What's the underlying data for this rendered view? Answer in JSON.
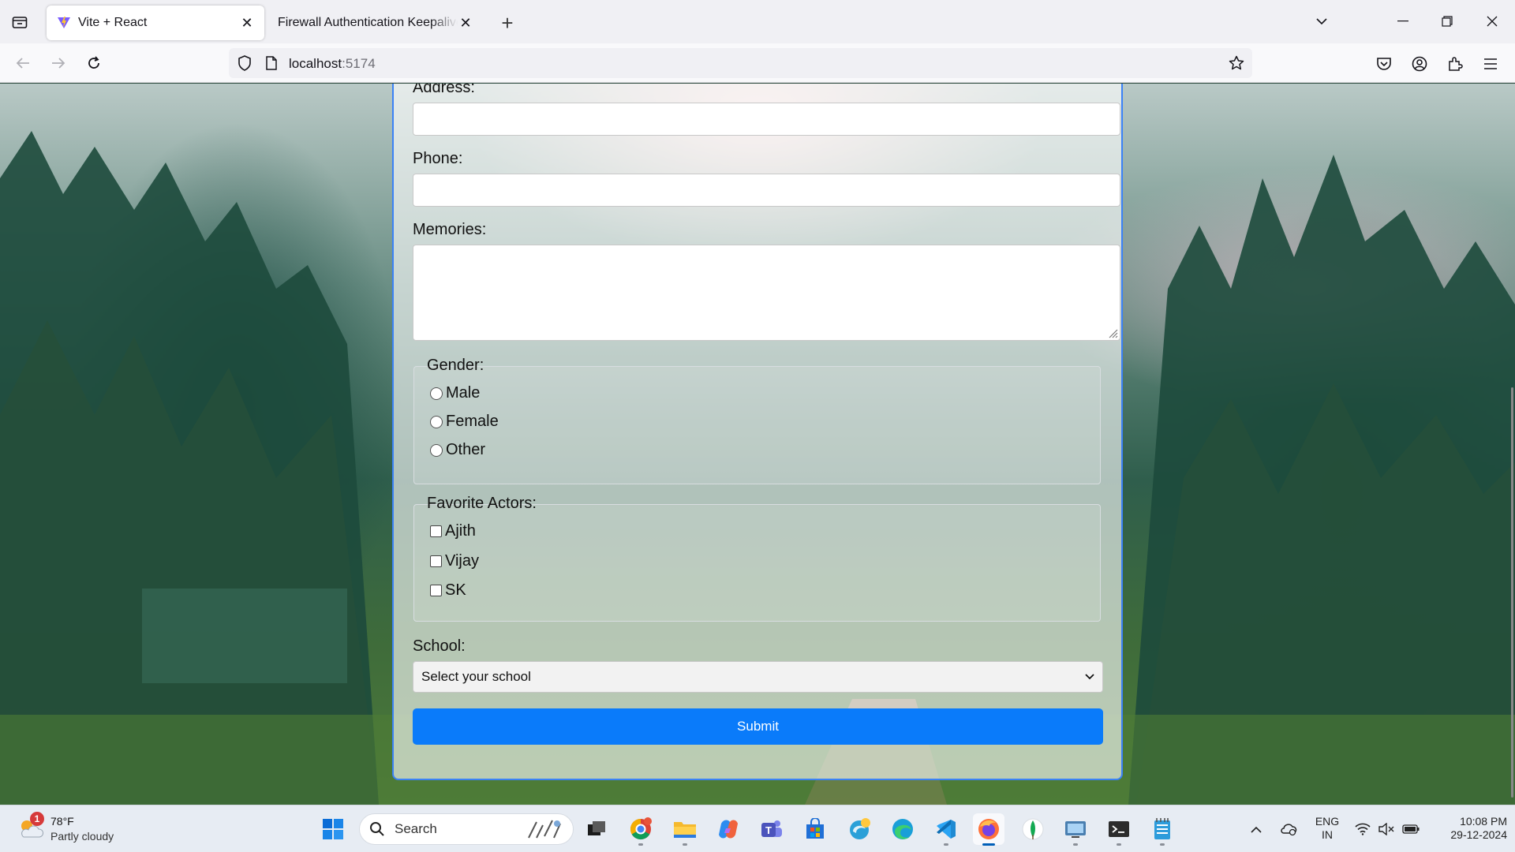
{
  "browser": {
    "tabs": [
      {
        "title": "Vite + React",
        "active": true
      },
      {
        "title": "Firewall Authentication Keepalive Window",
        "active": false
      }
    ],
    "url_host": "localhost",
    "url_port": ":5174"
  },
  "form": {
    "address_label": "Address:",
    "address_value": "",
    "phone_label": "Phone:",
    "phone_value": "",
    "memories_label": "Memories:",
    "memories_value": "",
    "gender": {
      "legend": "Gender:",
      "options": [
        "Male",
        "Female",
        "Other"
      ],
      "selected": null
    },
    "actors": {
      "legend": "Favorite Actors:",
      "options": [
        "Ajith",
        "Vijay",
        "SK"
      ],
      "checked": []
    },
    "school_label": "School:",
    "school_selected": "Select your school",
    "submit_label": "Submit"
  },
  "taskbar": {
    "weather_temp": "78°F",
    "weather_cond": "Partly cloudy",
    "weather_badge": "1",
    "search_placeholder": "Search",
    "lang_line1": "ENG",
    "lang_line2": "IN",
    "time": "10:08 PM",
    "date": "29-12-2024",
    "apps": [
      "start",
      "search",
      "task-view",
      "chrome",
      "file-explorer",
      "copilot",
      "teams",
      "store",
      "edge-dev",
      "edge",
      "vscode",
      "firefox",
      "mongodb-compass",
      "virtual-desktop",
      "terminal",
      "notepad"
    ]
  },
  "colors": {
    "accent": "#0a7bfa",
    "card_border": "#3b82f6"
  }
}
